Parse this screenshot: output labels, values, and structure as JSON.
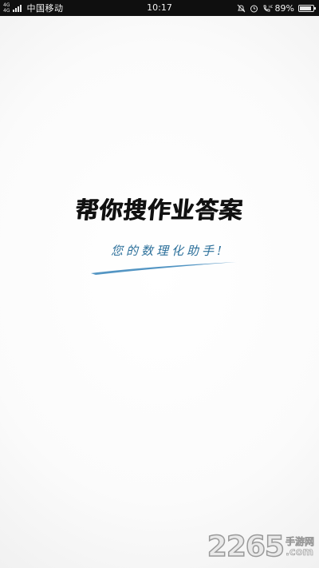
{
  "status_bar": {
    "network": "4G",
    "network_sub": "4G",
    "carrier": "中国移动",
    "time": "10:17",
    "battery_percent_text": "89%",
    "battery_level": 0.89,
    "icons": [
      "mute-icon",
      "alarm-icon",
      "volte-icon",
      "battery-icon"
    ]
  },
  "splash": {
    "title": "帮你搜作业答案",
    "slogan": "您的数理化助手!"
  },
  "watermark": {
    "number": "2265",
    "label": "手游网",
    "domain": ".com"
  },
  "colors": {
    "status_bar_bg": "#0f0f0f",
    "title": "#111111",
    "slogan": "#2b6f9a",
    "swoosh": "#4a8fc0"
  }
}
